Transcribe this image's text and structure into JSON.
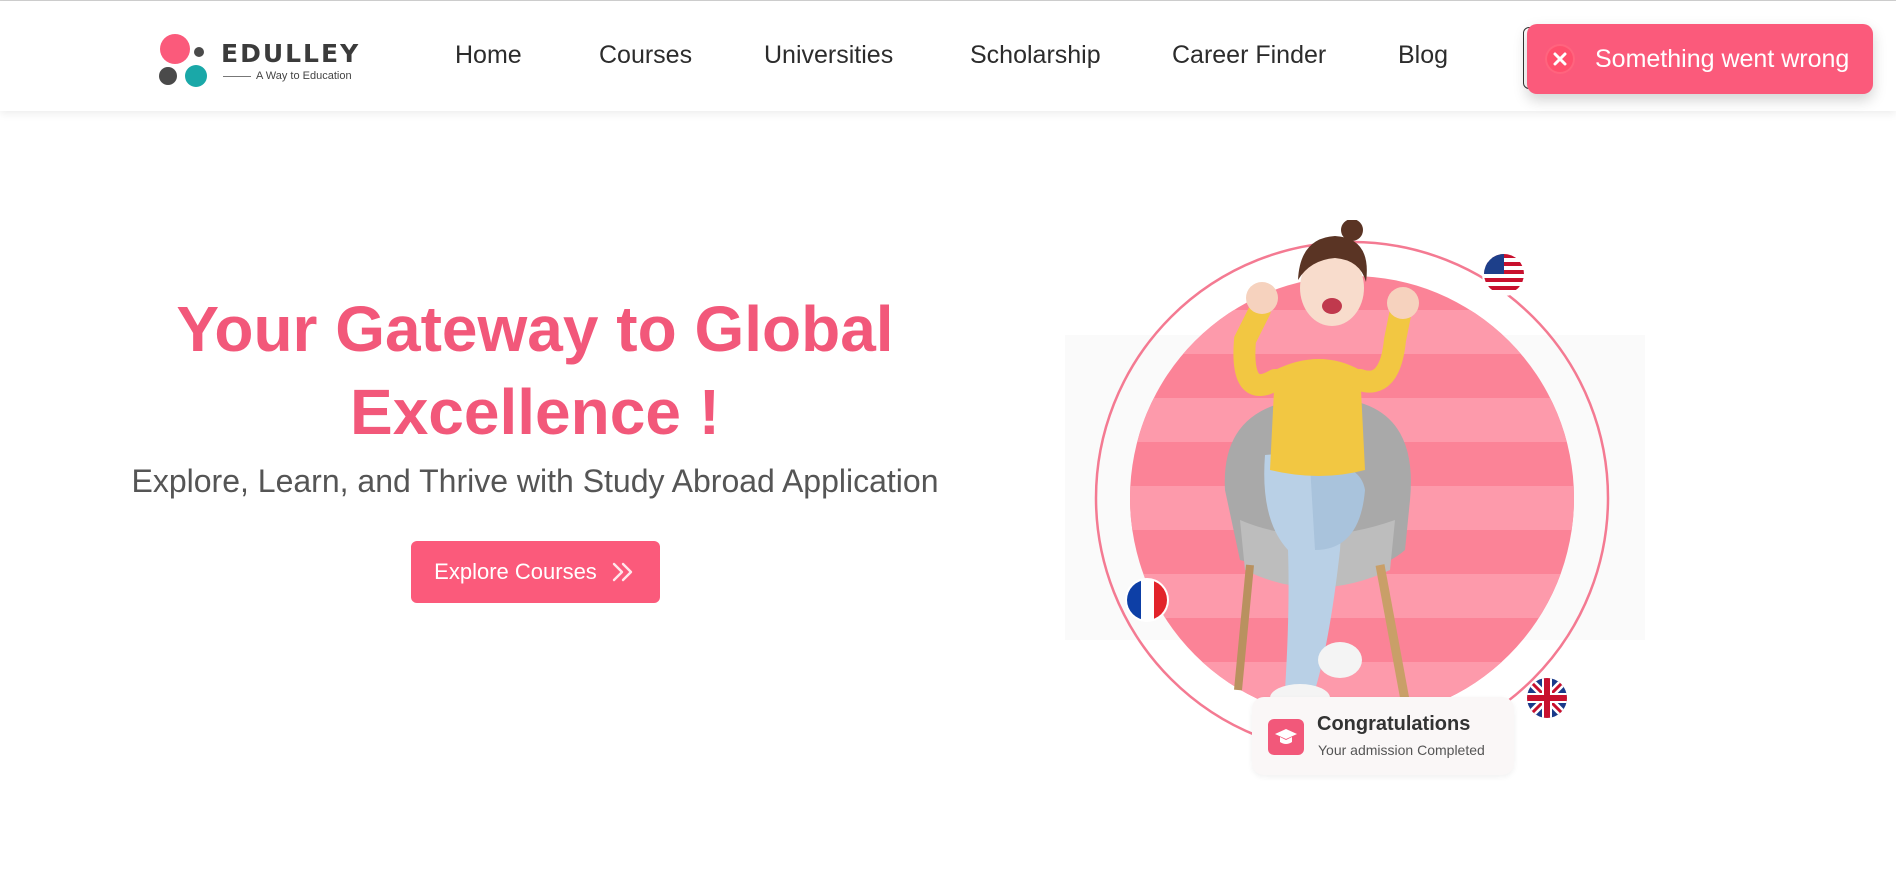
{
  "brand": {
    "name": "EDULLEY",
    "tagline": "A Way to Education",
    "colors": {
      "primary": "#fb5a7b",
      "heading": "#f2587a",
      "teal": "#1aa8a8",
      "dark": "#4a4a4a"
    }
  },
  "nav": {
    "items": [
      {
        "label": "Home"
      },
      {
        "label": "Courses"
      },
      {
        "label": "Universities"
      },
      {
        "label": "Scholarship"
      },
      {
        "label": "Career Finder"
      },
      {
        "label": "Blog"
      }
    ]
  },
  "toast": {
    "message": "Something went wrong",
    "icon": "close-icon",
    "type": "error"
  },
  "hero": {
    "title_line1": "Your Gateway to Global",
    "title_line2": "Excellence !",
    "subtitle": "Explore, Learn, and Thrive with Study Abroad Application",
    "cta_label": "Explore Courses",
    "cta_icon": "double-chevron-right-icon"
  },
  "hero_image": {
    "flags": [
      "usa-flag-icon",
      "france-flag-icon",
      "uk-flag-icon"
    ]
  },
  "congrats_card": {
    "title": "Congratulations",
    "subtitle": "Your admission Completed",
    "icon": "graduation-cap-icon"
  }
}
